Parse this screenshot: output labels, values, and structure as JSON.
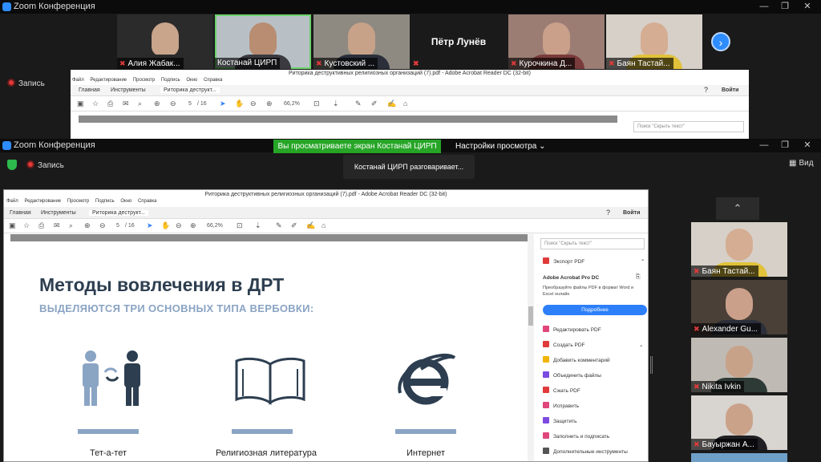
{
  "zoom_top": {
    "title": "Zoom Конференция"
  },
  "zoom_bottom": {
    "title": "Zoom Конференция"
  },
  "window_controls": {
    "minimize": "—",
    "restore": "❐",
    "close": "✕"
  },
  "participants_top": [
    {
      "name": "Алия Жабак...",
      "muted": true
    },
    {
      "name": "Костанай ЦИРП",
      "muted": false,
      "active": true
    },
    {
      "name": "Кустовский ...",
      "muted": true
    },
    {
      "name": "Пётр Лунёв",
      "muted": true,
      "video_off": true
    },
    {
      "name": "Курочкина Д...",
      "muted": true
    },
    {
      "name": "Баян Тастай...",
      "muted": true
    }
  ],
  "recording": {
    "label": "Запись"
  },
  "sharing_banner": "Вы просматриваете экран Костанай ЦИРП",
  "view_settings": "Настройки просмотра",
  "speaking_tooltip": "Костанай ЦИРП разговаривает...",
  "view_label": "Вид",
  "acrobat": {
    "title": "Риторика деструктивных религиозных организаций (7).pdf - Adobe Acrobat Reader DC (32-bit)",
    "menu": [
      "Файл",
      "Редактирование",
      "Просмотр",
      "Подпись",
      "Окно",
      "Справка"
    ],
    "tabs": {
      "home": "Главная",
      "tools": "Инструменты",
      "doc": "Риторика деструкт..."
    },
    "signin": "Войти",
    "page_current": "5",
    "page_total": "/ 16",
    "zoom": "66,2%",
    "search_placeholder": "Поиск \"Скрыть текст\""
  },
  "slide": {
    "title": "Методы вовлечения в ДРТ",
    "subtitle": "ВЫДЕЛЯЮТСЯ ТРИ ОСНОВНЫХ ТИПА ВЕРБОВКИ:",
    "columns": [
      "Тет-а-тет",
      "Религиозная литература",
      "Интернет"
    ]
  },
  "sidebar": {
    "export": "Экспорт PDF",
    "promo_title": "Adobe Acrobat Pro DC",
    "promo_text": "Преобразуйте файлы PDF в формат Word и Excel онлайн",
    "more_button": "Подробнее",
    "tools": [
      {
        "label": "Редактировать PDF",
        "color": "#e0457b"
      },
      {
        "label": "Создать PDF",
        "color": "#e03a3a"
      },
      {
        "label": "Добавить комментарий",
        "color": "#f2b400"
      },
      {
        "label": "Объединить файлы",
        "color": "#7b4ae0"
      },
      {
        "label": "Сжать PDF",
        "color": "#e03a3a"
      },
      {
        "label": "Исправить",
        "color": "#e0457b"
      },
      {
        "label": "Защитить",
        "color": "#7b4ae0"
      },
      {
        "label": "Заполнить и подписать",
        "color": "#e0457b"
      },
      {
        "label": "Дополнительные инструменты",
        "color": "#555555"
      }
    ]
  },
  "gallery_right": [
    {
      "name": "Баян Тастай...",
      "muted": true
    },
    {
      "name": "Alexander Gu...",
      "muted": true
    },
    {
      "name": "Nikita Ivkin",
      "muted": true
    },
    {
      "name": "Бауыржан А...",
      "muted": true
    }
  ]
}
